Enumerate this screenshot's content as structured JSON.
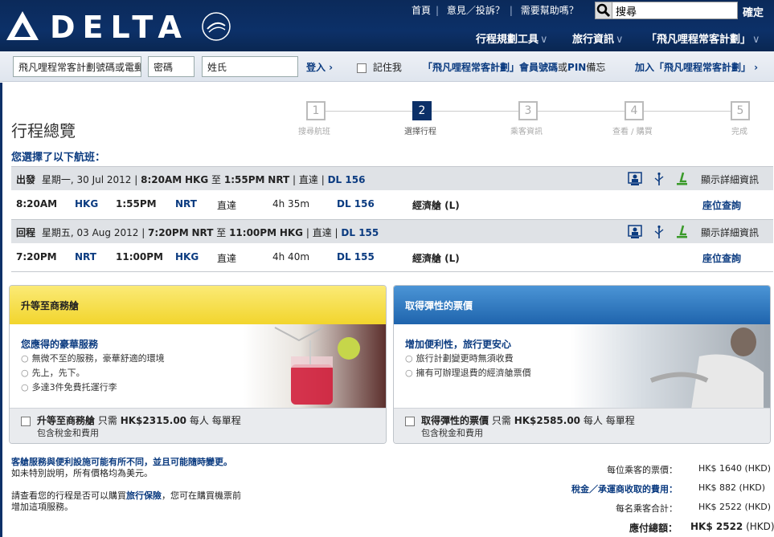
{
  "header": {
    "brand": "DELTA",
    "top_links": [
      "首頁",
      "意見／投訴？",
      "需要幫助嗎？"
    ],
    "search_value": "搜尋",
    "search_ok": "確定",
    "nav": [
      "行程規劃工具",
      "旅行資訊",
      "「飛凡哩程常客計劃」"
    ],
    "nav_chevron": "∨"
  },
  "login": {
    "account_placeholder": "飛凡哩程常客計劃號碼或電郵",
    "password_placeholder": "密碼",
    "surname_placeholder": "姓氏",
    "login_label": "登入 ›",
    "remember_label": "記住我",
    "forgot_link_a": "「飛凡哩程常客計劃」會員號碼",
    "forgot_link_or": "或",
    "forgot_link_b": "PIN",
    "forgot_link_c": "備忘",
    "join_link": "加入「飛凡哩程常客計劃」 ›"
  },
  "page": {
    "title": "行程總覽",
    "selected_title": "您選擇了以下航班："
  },
  "steps": [
    {
      "num": "1",
      "label": "搜尋航班",
      "active": false
    },
    {
      "num": "2",
      "label": "選擇行程",
      "active": true
    },
    {
      "num": "3",
      "label": "乘客資訊",
      "active": false
    },
    {
      "num": "4",
      "label": "查看 / 購買",
      "active": false
    },
    {
      "num": "5",
      "label": "完成",
      "active": false
    }
  ],
  "flights": [
    {
      "direction": "出發",
      "day": "星期一,",
      "date": "30 Jul 2012",
      "summary_dep_time": "8:20AM",
      "summary_dep_code": "HKG",
      "to": "至",
      "summary_arr_time": "1:55PM",
      "summary_arr_code": "NRT",
      "stops": "直達",
      "flight_no": "DL 156",
      "detail_link": "顯示詳細資訊",
      "dep_time": "8:20AM",
      "dep_code": "HKG",
      "arr_time": "1:55PM",
      "arr_code": "NRT",
      "stops_row": "直達",
      "duration": "4h 35m",
      "flight_no_row": "DL 156",
      "cabin": "經濟艙 (L)",
      "seat_link": "座位查詢"
    },
    {
      "direction": "回程",
      "day": "星期五,",
      "date": "03 Aug 2012",
      "summary_dep_time": "7:20PM",
      "summary_dep_code": "NRT",
      "to": "至",
      "summary_arr_time": "11:00PM",
      "summary_arr_code": "HKG",
      "stops": "直達",
      "flight_no": "DL 155",
      "detail_link": "顯示詳細資訊",
      "dep_time": "7:20PM",
      "dep_code": "NRT",
      "arr_time": "11:00PM",
      "arr_code": "HKG",
      "stops_row": "直達",
      "duration": "4h 40m",
      "flight_no_row": "DL 155",
      "cabin": "經濟艙 (L)",
      "seat_link": "座位查詢"
    }
  ],
  "promos": [
    {
      "title": "升等至商務艙",
      "subtitle": "您應得的豪華服務",
      "items": [
        "無微不至的服務，豪華舒適的環境",
        "先上，先下。",
        "多達3件免費托運行李"
      ],
      "option_name": "升等至商務艙",
      "option_only": "只需",
      "option_price": "HK$2315.00",
      "option_per": "每人 每單程",
      "option_note": "包含稅金和費用",
      "head_color": "#f9e25a"
    },
    {
      "title": "取得彈性的票價",
      "subtitle": "增加便利性，旅行更安心",
      "items": [
        "旅行計劃變更時無須收費",
        "擁有可辦理退費的經濟艙票價"
      ],
      "option_name": "取得彈性的票價",
      "option_only": "只需",
      "option_price": "HK$2585.00",
      "option_per": "每人 每單程",
      "option_note": "包含稅金和費用",
      "head_color": "#2f7cc4"
    }
  ],
  "notice": {
    "line1": "客艙服務與便利設施可能有所不同，並且可能隨時變更。",
    "line2": "如未特別說明，所有價格均為美元。",
    "line3a": "請查看您的行程是否可以購買",
    "line3b": "旅行保險",
    "line3c": "，您可在購買機票前",
    "line4": "增加這項服務。"
  },
  "fares": [
    {
      "label": "每位乘客的票價：",
      "value": "HK$ 1640 (HKD)",
      "bold": false
    },
    {
      "label": "稅金／承運商收取的費用：",
      "value": "HK$ 882 (HKD)",
      "bold": false
    },
    {
      "label": "每名乘客合計：",
      "value": "HK$ 2522 (HKD)",
      "bold": false
    },
    {
      "label": "應付總額：",
      "value_bold": "HK$ 2522",
      "value_rest": " (HKD)",
      "bold": true
    }
  ]
}
